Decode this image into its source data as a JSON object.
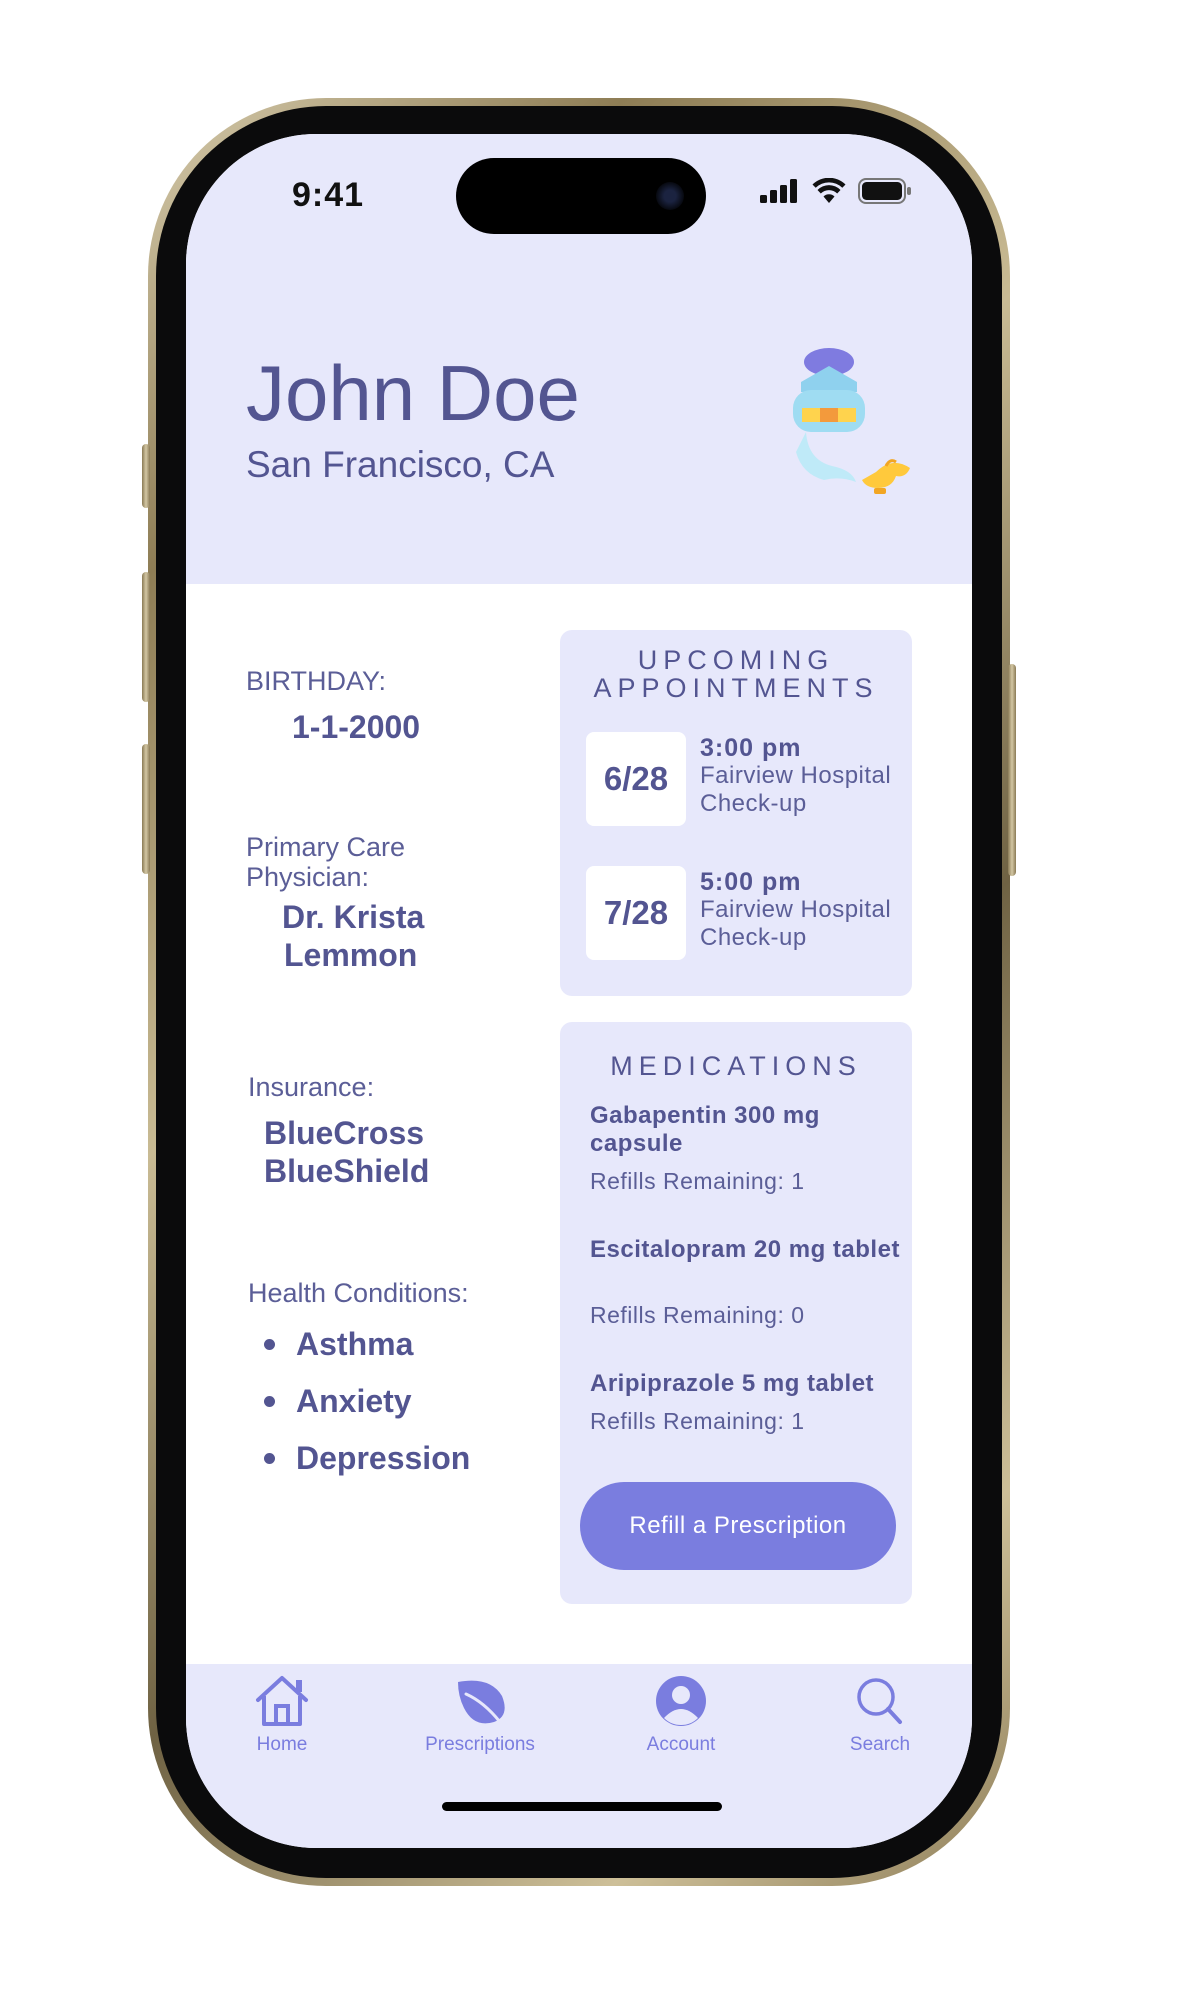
{
  "status_bar": {
    "time": "9:41"
  },
  "profile": {
    "name": "John Doe",
    "location": "San Francisco, CA"
  },
  "details": {
    "birthday_label": "BIRTHDAY:",
    "birthday_value": "1-1-2000",
    "pcp_label_line1": "Primary Care",
    "pcp_label_line2": "Physician:",
    "pcp_value_line1": "Dr. Krista",
    "pcp_value_line2": "Lemmon",
    "insurance_label": "Insurance:",
    "insurance_value_line1": "BlueCross",
    "insurance_value_line2": "BlueShield",
    "conditions_label": "Health Conditions:",
    "conditions": [
      "Asthma",
      "Anxiety",
      "Depression"
    ]
  },
  "appointments": {
    "title_line1": "UPCOMING",
    "title_line2": "APPOINTMENTS",
    "items": [
      {
        "date": "6/28",
        "time": "3:00 pm",
        "place": "Fairview Hospital",
        "type": "Check-up"
      },
      {
        "date": "7/28",
        "time": "5:00 pm",
        "place": "Fairview Hospital",
        "type": "Check-up"
      }
    ]
  },
  "medications": {
    "title": "MEDICATIONS",
    "items": [
      {
        "name": "Gabapentin 300 mg capsule",
        "refills": "Refills Remaining: 1"
      },
      {
        "name": "Escitalopram 20 mg tablet",
        "refills": "Refills Remaining: 0"
      },
      {
        "name": "Aripiprazole 5 mg tablet",
        "refills": "Refills Remaining: 1"
      }
    ],
    "refill_button": "Refill a Prescription"
  },
  "tabbar": {
    "tabs": [
      {
        "label": "Home",
        "icon": "home-icon"
      },
      {
        "label": "Prescriptions",
        "icon": "leaf-icon"
      },
      {
        "label": "Account",
        "icon": "account-icon"
      },
      {
        "label": "Search",
        "icon": "search-icon"
      }
    ]
  },
  "colors": {
    "primary_text": "#535591",
    "header_bg": "#e7e8fb",
    "accent": "#7a7ddf"
  }
}
